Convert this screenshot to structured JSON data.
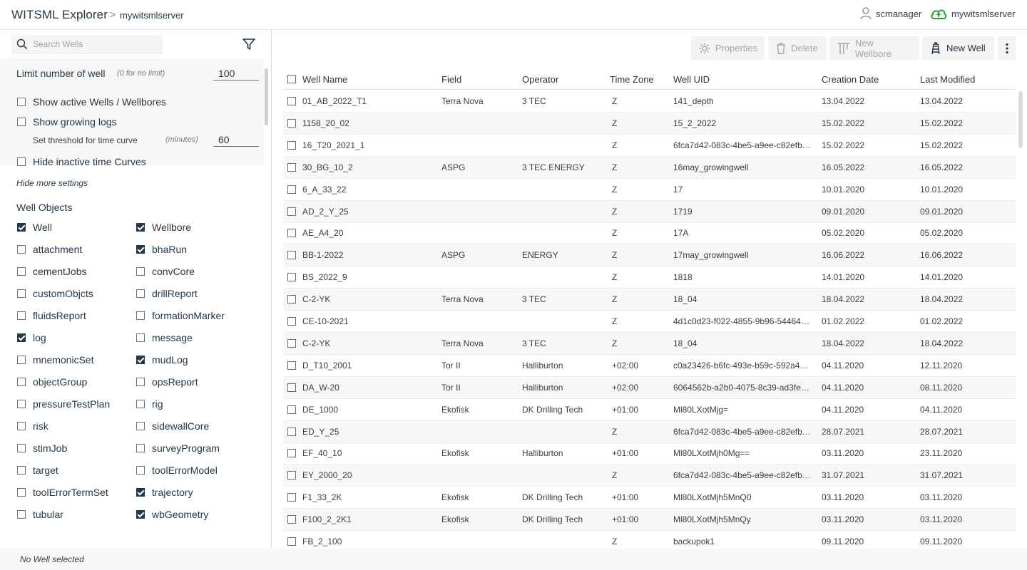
{
  "header": {
    "app_title": "WITSML Explorer",
    "breadcrumb_sep": ">",
    "server_crumb": "mywitsmlserver",
    "user": "scmanager",
    "server": "mywitsmlserver"
  },
  "sidebar": {
    "search_placeholder": "Search Wells",
    "limit_label": "Limit number of well",
    "limit_hint": "(0 for no limit)",
    "limit_value": "100",
    "show_active": {
      "label": "Show active Wells / Wellbores",
      "checked": false
    },
    "show_growing": {
      "label": "Show growing logs",
      "checked": false
    },
    "threshold_label": "Set threshold for time curve",
    "threshold_hint": "(minutes)",
    "threshold_value": "60",
    "hide_inactive": {
      "label": "Hide inactive time Curves",
      "checked": false
    },
    "hide_more": "Hide more settings",
    "well_objects_title": "Well Objects",
    "well_objects": [
      {
        "label": "Well",
        "checked": true
      },
      {
        "label": "Wellbore",
        "checked": true
      },
      {
        "label": "attachment",
        "checked": false
      },
      {
        "label": "bhaRun",
        "checked": true
      },
      {
        "label": "cementJobs",
        "checked": false
      },
      {
        "label": "convCore",
        "checked": false
      },
      {
        "label": "customObjcts",
        "checked": false
      },
      {
        "label": "drillReport",
        "checked": false
      },
      {
        "label": "fluidsReport",
        "checked": false
      },
      {
        "label": "formationMarker",
        "checked": false
      },
      {
        "label": "log",
        "checked": true
      },
      {
        "label": "message",
        "checked": false
      },
      {
        "label": "mnemonicSet",
        "checked": false
      },
      {
        "label": "mudLog",
        "checked": true
      },
      {
        "label": "objectGroup",
        "checked": false
      },
      {
        "label": "opsReport",
        "checked": false
      },
      {
        "label": "pressureTestPlan",
        "checked": false
      },
      {
        "label": "rig",
        "checked": false
      },
      {
        "label": "risk",
        "checked": false
      },
      {
        "label": "sidewallCore",
        "checked": false
      },
      {
        "label": "stimJob",
        "checked": false
      },
      {
        "label": "surveyProgram",
        "checked": false
      },
      {
        "label": "target",
        "checked": false
      },
      {
        "label": "toolErrorModel",
        "checked": false
      },
      {
        "label": "toolErrorTermSet",
        "checked": false
      },
      {
        "label": "trajectory",
        "checked": true
      },
      {
        "label": "tubular",
        "checked": false
      },
      {
        "label": "wbGeometry",
        "checked": true
      }
    ]
  },
  "toolbar": {
    "properties": "Properties",
    "delete": "Delete",
    "new_wellbore": "New Wellbore",
    "new_well": "New Well"
  },
  "table": {
    "columns": [
      "Well Name",
      "Field",
      "Operator",
      "Time Zone",
      "Well UID",
      "Creation Date",
      "Last Modified"
    ],
    "rows": [
      [
        "01_AB_2022_T1",
        "Terra Nova",
        "3 TEC",
        "Z",
        "141_depth",
        "13.04.2022",
        "13.04.2022"
      ],
      [
        "1158_20_02",
        "",
        "",
        "Z",
        "15_2_2022",
        "15.02.2022",
        "15.02.2022"
      ],
      [
        "16_T20_2021_1",
        "",
        "",
        "Z",
        "6fca7d42-083c-4be5-a9ee-c82efb…",
        "15.02.2022",
        "15.02.2022"
      ],
      [
        "30_BG_10_2",
        "ASPG",
        "3 TEC ENERGY",
        "Z",
        "16may_growingwell",
        "16.05.2022",
        "16.05.2022"
      ],
      [
        "6_A_33_22",
        "",
        "",
        "Z",
        "17",
        "10.01.2020",
        "10.01.2020"
      ],
      [
        "AD_2_Y_25",
        "",
        "",
        "Z",
        "1719",
        "09.01.2020",
        "09.01.2020"
      ],
      [
        "AE_A4_20",
        "",
        "",
        "Z",
        "17A",
        "05.02.2020",
        "05.02.2020"
      ],
      [
        "BB-1-2022",
        "ASPG",
        "ENERGY",
        "Z",
        "17may_growingwell",
        "16.06.2022",
        "16.06.2022"
      ],
      [
        "BS_2022_9",
        "",
        "",
        "Z",
        "1818",
        "14.01.2020",
        "14.01.2020"
      ],
      [
        "C-2-YK",
        "Terra Nova",
        "3 TEC",
        "Z",
        "18_04",
        "18.04.2022",
        "18.04.2022"
      ],
      [
        "CE-10-2021",
        "",
        "",
        "Z",
        "4d1c0d23-f022-4855-9b96-54464…",
        "01.02.2022",
        "01.02.2022"
      ],
      [
        "C-2-YK",
        "Terra Nova",
        "3 TEC",
        "Z",
        "18_04",
        "18.04.2022",
        "18.04.2022"
      ],
      [
        "D_T10_2001",
        "Tor II",
        "Halliburton",
        "+02:00",
        "c0a23426-b6fc-493e-b59c-592a4…",
        "04.11.2020",
        "12.11.2020"
      ],
      [
        "DA_W-20",
        "Tor II",
        "Halliburton",
        "+02:00",
        "6064562b-a2b0-4075-8c39-ad3fe…",
        "04.11.2020",
        "08.11.2020"
      ],
      [
        "DE_1000",
        "Ekofisk",
        "DK Drilling Tech",
        "+01:00",
        "Ml80LXotMjg=",
        "04.11.2020",
        "04.11.2020"
      ],
      [
        "ED_Y_25",
        "",
        "",
        "Z",
        "6fca7d42-083c-4be5-a9ee-c82efb…",
        "28.07.2021",
        "28.07.2021"
      ],
      [
        "EF_40_10",
        "Ekofisk",
        "Halliburton",
        "+01:00",
        "Ml80LXotMjh0Mg==",
        "03.11.2020",
        "23.11.2020"
      ],
      [
        "EY_2000_20",
        "",
        "",
        "Z",
        "6fca7d42-083c-4be5-a9ee-c82efb…",
        "31.07.2021",
        "31.07.2021"
      ],
      [
        "F1_33_2K",
        "Ekofisk",
        "DK Drilling Tech",
        "+01:00",
        "Ml80LXotMjh5MnQ0",
        "03.11.2020",
        "03.11.2020"
      ],
      [
        "F100_2_2K1",
        "Ekofisk",
        "DK Drilling Tech",
        "+01:00",
        "Ml80LXotMjh5MnQy",
        "03.11.2020",
        "03.11.2020"
      ],
      [
        "FB_2_100",
        "",
        "",
        "Z",
        "backupok1",
        "09.11.2020",
        "09.11.2020"
      ]
    ]
  },
  "footer": {
    "status": "No Well selected"
  }
}
